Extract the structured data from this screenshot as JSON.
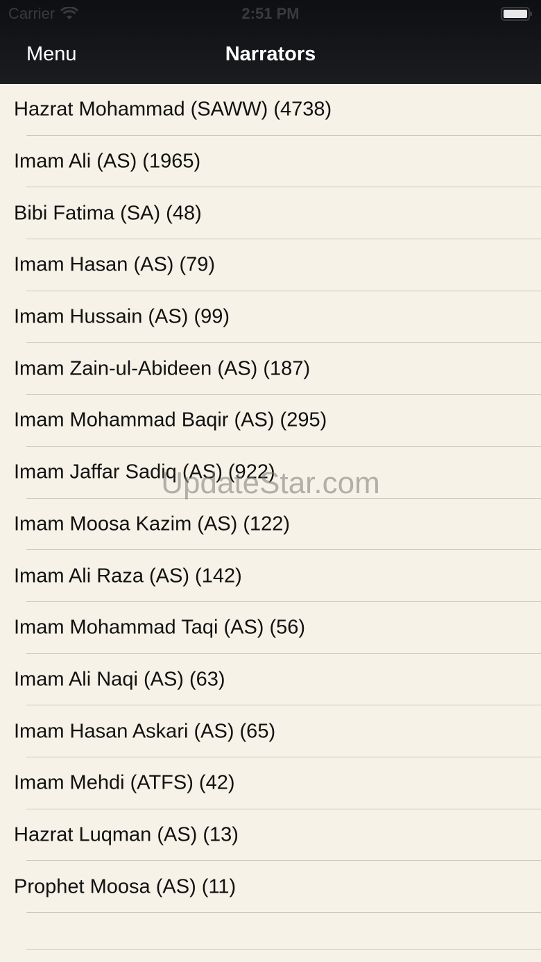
{
  "status_bar": {
    "carrier": "Carrier",
    "time": "2:51 PM"
  },
  "nav": {
    "menu_label": "Menu",
    "title": "Narrators"
  },
  "narrators": [
    {
      "label": "Hazrat Mohammad (SAWW) (4738)"
    },
    {
      "label": "Imam Ali (AS) (1965)"
    },
    {
      "label": "Bibi Fatima (SA) (48)"
    },
    {
      "label": "Imam Hasan (AS) (79)"
    },
    {
      "label": "Imam Hussain (AS) (99)"
    },
    {
      "label": "Imam Zain-ul-Abideen (AS) (187)"
    },
    {
      "label": "Imam Mohammad Baqir (AS) (295)"
    },
    {
      "label": "Imam Jaffar Sadiq (AS) (922)"
    },
    {
      "label": "Imam Moosa Kazim (AS) (122)"
    },
    {
      "label": "Imam Ali Raza (AS) (142)"
    },
    {
      "label": "Imam Mohammad Taqi (AS) (56)"
    },
    {
      "label": "Imam Ali Naqi (AS) (63)"
    },
    {
      "label": "Imam Hasan Askari (AS) (65)"
    },
    {
      "label": "Imam Mehdi (ATFS) (42)"
    },
    {
      "label": "Hazrat Luqman (AS) (13)"
    },
    {
      "label": "Prophet Moosa (AS) (11)"
    }
  ],
  "watermark": "UpdateStar.com",
  "icons": {
    "wifi": "wifi-icon",
    "battery": "battery-icon"
  },
  "colors": {
    "nav_background": "#141518",
    "list_background": "#f6f2e7",
    "separator": "#c9c6bd",
    "text": "#111111"
  }
}
